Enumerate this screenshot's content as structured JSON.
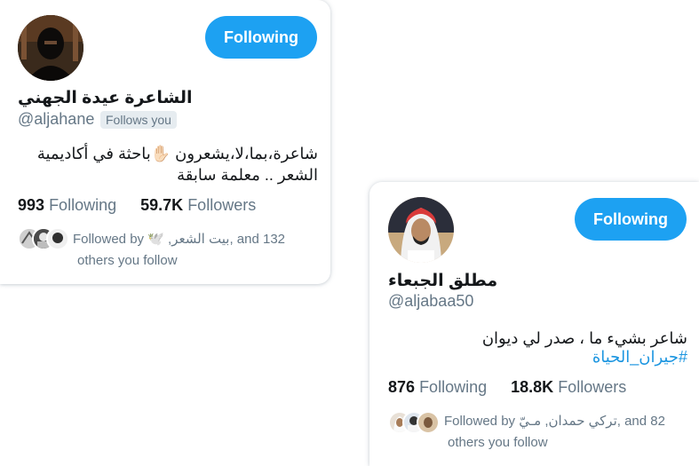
{
  "cards": [
    {
      "id": "card1",
      "button_label": "Following",
      "display_name": "الشاعرة عيدة الجهني",
      "handle": "@aljahane",
      "follows_you": "Follows you",
      "bio_line1": "شاعرة،بما،لا،يشعرون ✋🏻باحثة في أكاديمية",
      "bio_line2": "الشعر .. معلمة سابقة",
      "following_count": "993",
      "following_label": "Following",
      "followers_count": "59.7K",
      "followers_label": "Followers",
      "followed_by_line1": "Followed by 🕊️ ,بيت الشعر, and 132",
      "followed_by_line2": "others you follow"
    },
    {
      "id": "card2",
      "button_label": "Following",
      "display_name": "مطلق الجبعاء",
      "handle": "@aljabaa50",
      "bio_line1": "شاعر بشيء ما ، صدر لي ديوان",
      "hashtag": "#جيران_الحياة",
      "following_count": "876",
      "following_label": "Following",
      "followers_count": "18.8K",
      "followers_label": "Followers",
      "followed_by_line1": "Followed by تركي حمدان, مـيّ, and 82",
      "followed_by_line2": "others you follow"
    }
  ],
  "colors": {
    "accent": "#1da1f2",
    "secondary_text": "#657786",
    "hashtag": "#1b95e0"
  }
}
